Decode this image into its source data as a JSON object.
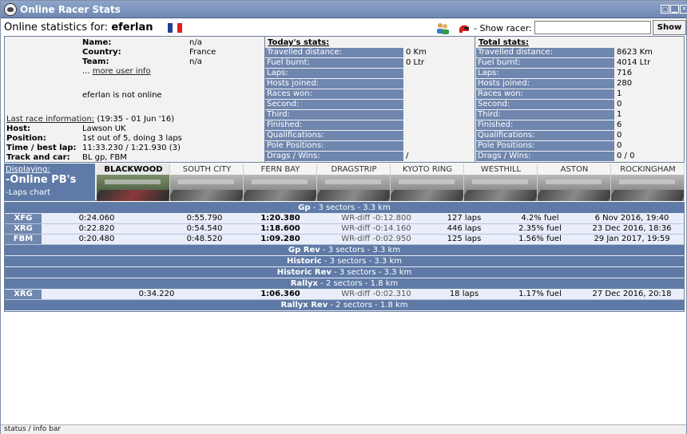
{
  "window": {
    "title": "Online Racer Stats"
  },
  "header": {
    "online_label": "Online statistics for:",
    "racer_name": "eferlan",
    "flag_colors": [
      "#1f3f9a",
      "#ffffff",
      "#e02020"
    ],
    "show_racer_label": "- Show racer:",
    "show_racer_value": "",
    "show_button": "Show",
    "icons": [
      "friends-icon",
      "helmet-icon"
    ]
  },
  "profile": {
    "name_key": "Name:",
    "name_val": "n/a",
    "country_key": "Country:",
    "country_val": "France",
    "team_key": "Team:",
    "team_val": "n/a",
    "more_prefix": "...",
    "more_link": "more user info",
    "online_status": "eferlan is not online",
    "last_race_link": "Last race information:",
    "last_race_time": "(19:35 - 01 Jun '16)",
    "host_key": "Host:",
    "host_val": "Lawson UK",
    "position_key": "Position:",
    "position_val": "1st out of 5, doing 3 laps",
    "time_key": "Time / best lap:",
    "time_val": "11:33.230 / 1:21.930 (3)",
    "track_key": "Track and car:",
    "track_val": "BL gp, FBM"
  },
  "today": {
    "heading": "Today's stats:",
    "rows": [
      {
        "k": "Travelled distance:",
        "v": "0 Km"
      },
      {
        "k": "Fuel burnt:",
        "v": "0 Ltr"
      },
      {
        "k": "Laps:",
        "v": ""
      },
      {
        "k": "Hosts joined:",
        "v": ""
      },
      {
        "k": "Races won:",
        "v": ""
      },
      {
        "k": "Second:",
        "v": ""
      },
      {
        "k": "Third:",
        "v": ""
      },
      {
        "k": "Finished:",
        "v": ""
      },
      {
        "k": "Qualifications:",
        "v": ""
      },
      {
        "k": "Pole Positions:",
        "v": ""
      },
      {
        "k": "Drags / Wins:",
        "v": "/"
      }
    ]
  },
  "total": {
    "heading": "Total stats:",
    "rows": [
      {
        "k": "Travelled distance:",
        "v": "8623 Km"
      },
      {
        "k": "Fuel burnt:",
        "v": "4014 Ltr"
      },
      {
        "k": "Laps:",
        "v": "716"
      },
      {
        "k": "Hosts joined:",
        "v": "280"
      },
      {
        "k": "Races won:",
        "v": "1"
      },
      {
        "k": "Second:",
        "v": "0"
      },
      {
        "k": "Third:",
        "v": "1"
      },
      {
        "k": "Finished:",
        "v": "6"
      },
      {
        "k": "Qualifications:",
        "v": "0"
      },
      {
        "k": "Pole Positions:",
        "v": "0"
      },
      {
        "k": "Drags / Wins:",
        "v": "0 / 0"
      }
    ]
  },
  "display": {
    "label": "Displaying:",
    "mode": "-Online PB's",
    "alt": "-Laps chart"
  },
  "tracks": [
    "BLACKWOOD",
    "SOUTH CITY",
    "FERN BAY",
    "DRAGSTRIP",
    "KYOTO RING",
    "WESTHILL",
    "ASTON",
    "ROCKINGHAM"
  ],
  "active_track": "BLACKWOOD",
  "results": [
    {
      "band": "Gp",
      "info": " - 3 sectors - 3.3 km"
    },
    {
      "car": "XFG",
      "s1": "0:24.060",
      "s2": "0:55.790",
      "lap": "1:20.380",
      "wr": "WR-diff -0:12.800",
      "laps": "127 laps",
      "fuel": "4.2% fuel",
      "date": "6 Nov 2016, 19:40"
    },
    {
      "car": "XRG",
      "s1": "0:22.820",
      "s2": "0:54.540",
      "lap": "1:18.600",
      "wr": "WR-diff -0:14.160",
      "laps": "446 laps",
      "fuel": "2.35% fuel",
      "date": "23 Dec 2016, 18:36"
    },
    {
      "car": "FBM",
      "s1": "0:20.480",
      "s2": "0:48.520",
      "lap": "1:09.280",
      "wr": "WR-diff -0:02.950",
      "laps": "125 laps",
      "fuel": "1.56% fuel",
      "date": "29 Jan 2017, 19:59"
    },
    {
      "band": "Gp Rev",
      "info": " - 3 sectors - 3.3 km"
    },
    {
      "band": "Historic",
      "info": " - 3 sectors - 3.3 km"
    },
    {
      "band": "Historic Rev",
      "info": " - 3 sectors - 3.3 km"
    },
    {
      "band": "Rallyx",
      "info": " - 2 sectors - 1.8 km"
    },
    {
      "car": "XRG",
      "s1": "0:34.220",
      "s2": "",
      "lap": "1:06.360",
      "wr": "WR-diff -0:02.310",
      "laps": "18 laps",
      "fuel": "1.17% fuel",
      "date": "27 Dec 2016, 20:18",
      "two_sector": true
    },
    {
      "band": "Rallyx Rev",
      "info": " - 2 sectors - 1.8 km"
    }
  ],
  "status_bar": "status / info bar"
}
